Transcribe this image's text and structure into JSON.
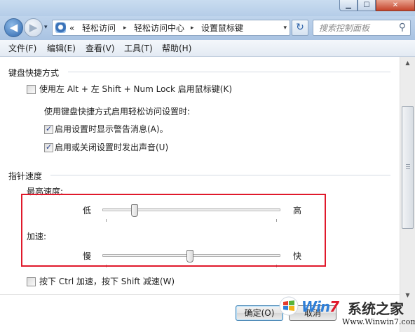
{
  "titlebar": {
    "minimize_glyph": "▁",
    "maximize_glyph": "☐",
    "close_glyph": "✕"
  },
  "nav": {
    "back_icon": "back-arrow",
    "back_glyph": "◀",
    "forward_icon": "forward-arrow",
    "forward_glyph": "▶",
    "history_glyph": "▾"
  },
  "address": {
    "overflow": "«",
    "breadcrumbs": [
      "轻松访问",
      "轻松访问中心",
      "设置鼠标键"
    ],
    "sep": "▸",
    "dropdown_glyph": "▾"
  },
  "refresh_glyph": "↻",
  "search": {
    "placeholder": "搜索控制面板",
    "value": "",
    "icon_glyph": "⚲"
  },
  "menu": [
    "文件(F)",
    "编辑(E)",
    "查看(V)",
    "工具(T)",
    "帮助(H)"
  ],
  "keyboard_shortcut": {
    "heading": "键盘快捷方式",
    "enable_label": "使用左 Alt + 左 Shift + Num Lock 启用鼠标键(K)",
    "enable_checked": false,
    "sub_heading": "使用键盘快捷方式启用轻松访问设置时:",
    "warning_label": "启用设置时显示警告消息(A)。",
    "warning_checked": true,
    "sound_label": "启用或关闭设置时发出声音(U)",
    "sound_checked": true
  },
  "pointer_speed": {
    "heading": "指针速度",
    "top_speed_label": "最高速度:",
    "top_speed_low": "低",
    "top_speed_high": "高",
    "top_speed_value": 0.18,
    "accel_label": "加速:",
    "accel_low": "慢",
    "accel_high": "快",
    "accel_value": 0.5,
    "ctrl_shift_label": "按下 Ctrl 加速，按下 Shift 减速(W)",
    "ctrl_shift_checked": false
  },
  "buttons": {
    "ok": "确定(O)",
    "cancel": "取消"
  },
  "scrollbar": {
    "up_glyph": "▲",
    "down_glyph": "▼"
  },
  "watermark": {
    "brand_a": "Win",
    "brand_num": "7",
    "brand_cn": "系统之家",
    "url": "Www.Winwin7.com"
  },
  "colors": {
    "highlight": "#e0192b",
    "accent": "#2f7fd8"
  }
}
